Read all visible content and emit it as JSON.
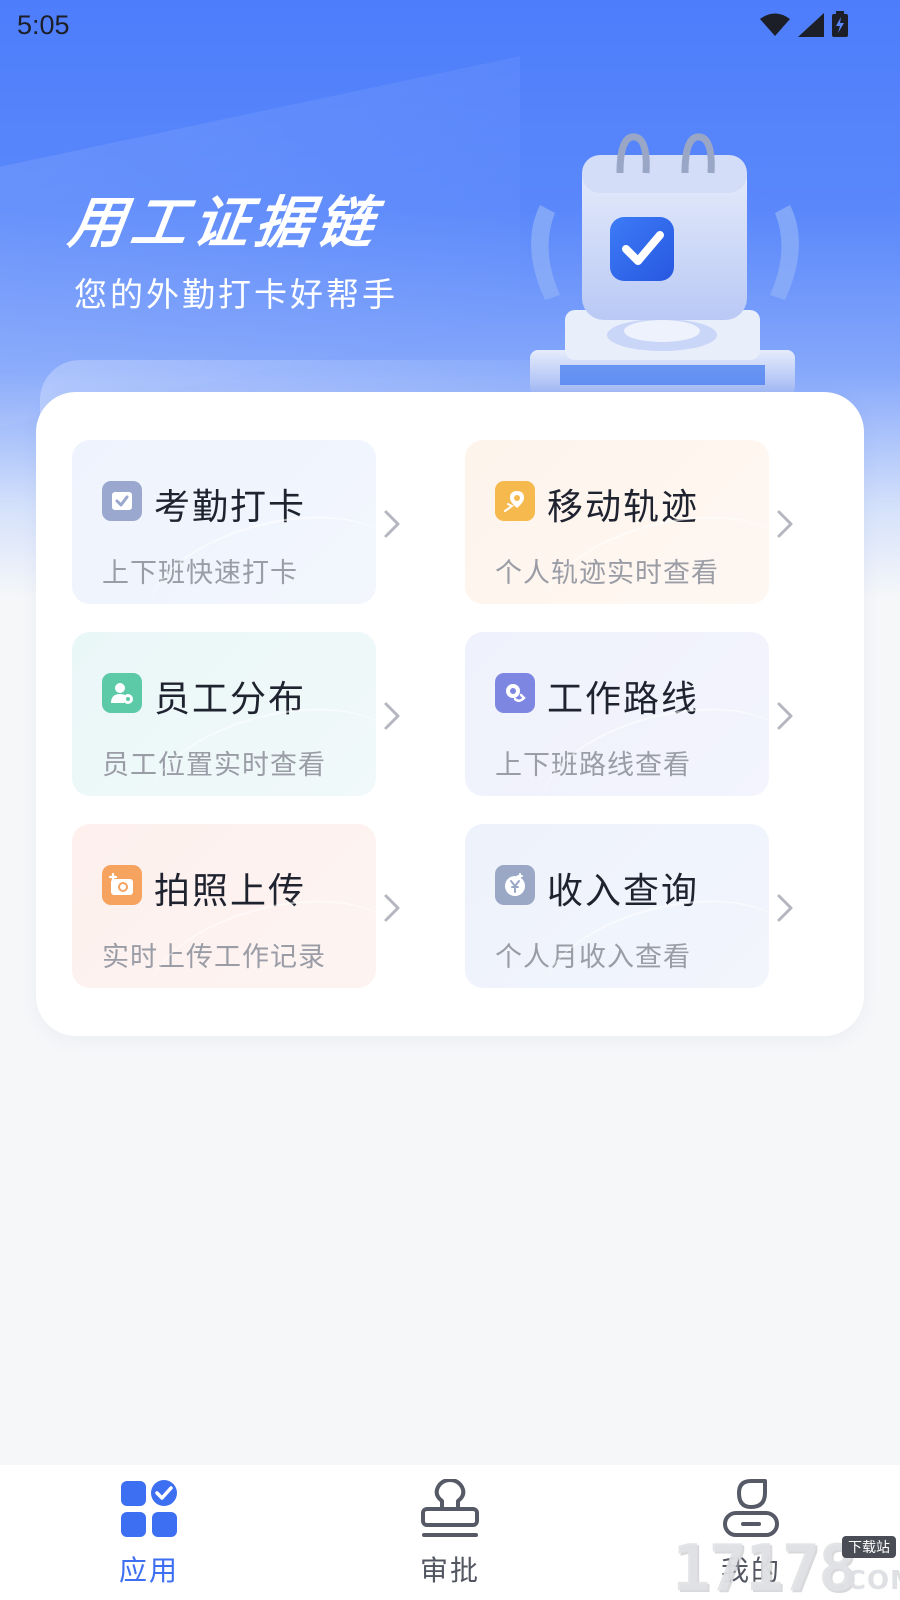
{
  "status_bar": {
    "time": "5:05",
    "icons": [
      "wifi-icon",
      "signal-icon",
      "battery-charging-icon"
    ]
  },
  "header": {
    "title": "用工证据链",
    "subtitle": "您的外勤打卡好帮手",
    "illustration": "calendar-checkmark-illustration"
  },
  "features": [
    {
      "title": "考勤打卡",
      "subtitle": "上下班快速打卡",
      "icon": "attendance-check-icon",
      "color": "#9aa8cf"
    },
    {
      "title": "移动轨迹",
      "subtitle": "个人轨迹实时查看",
      "icon": "map-pin-icon",
      "color": "#f6b94d"
    },
    {
      "title": "员工分布",
      "subtitle": "员工位置实时查看",
      "icon": "person-location-icon",
      "color": "#5cc9a7"
    },
    {
      "title": "工作路线",
      "subtitle": "上下班路线查看",
      "icon": "route-icon",
      "color": "#7d86e0"
    },
    {
      "title": "拍照上传",
      "subtitle": "实时上传工作记录",
      "icon": "camera-add-icon",
      "color": "#f6a35f"
    },
    {
      "title": "收入查询",
      "subtitle": "个人月收入查看",
      "icon": "income-yen-icon",
      "color": "#9aa8c6"
    }
  ],
  "tabbar": {
    "tabs": [
      {
        "label": "应用",
        "icon": "apps-grid-icon",
        "active": true
      },
      {
        "label": "审批",
        "icon": "stamp-icon",
        "active": false
      },
      {
        "label": "我的",
        "icon": "person-icon",
        "active": false
      }
    ]
  },
  "watermark": {
    "number": "17178",
    "top_label": "下载站",
    "suffix": ".COM"
  },
  "colors": {
    "accent": "#3d6ff2",
    "hero_top": "#4d7dfb",
    "background": "#f6f7f9"
  }
}
